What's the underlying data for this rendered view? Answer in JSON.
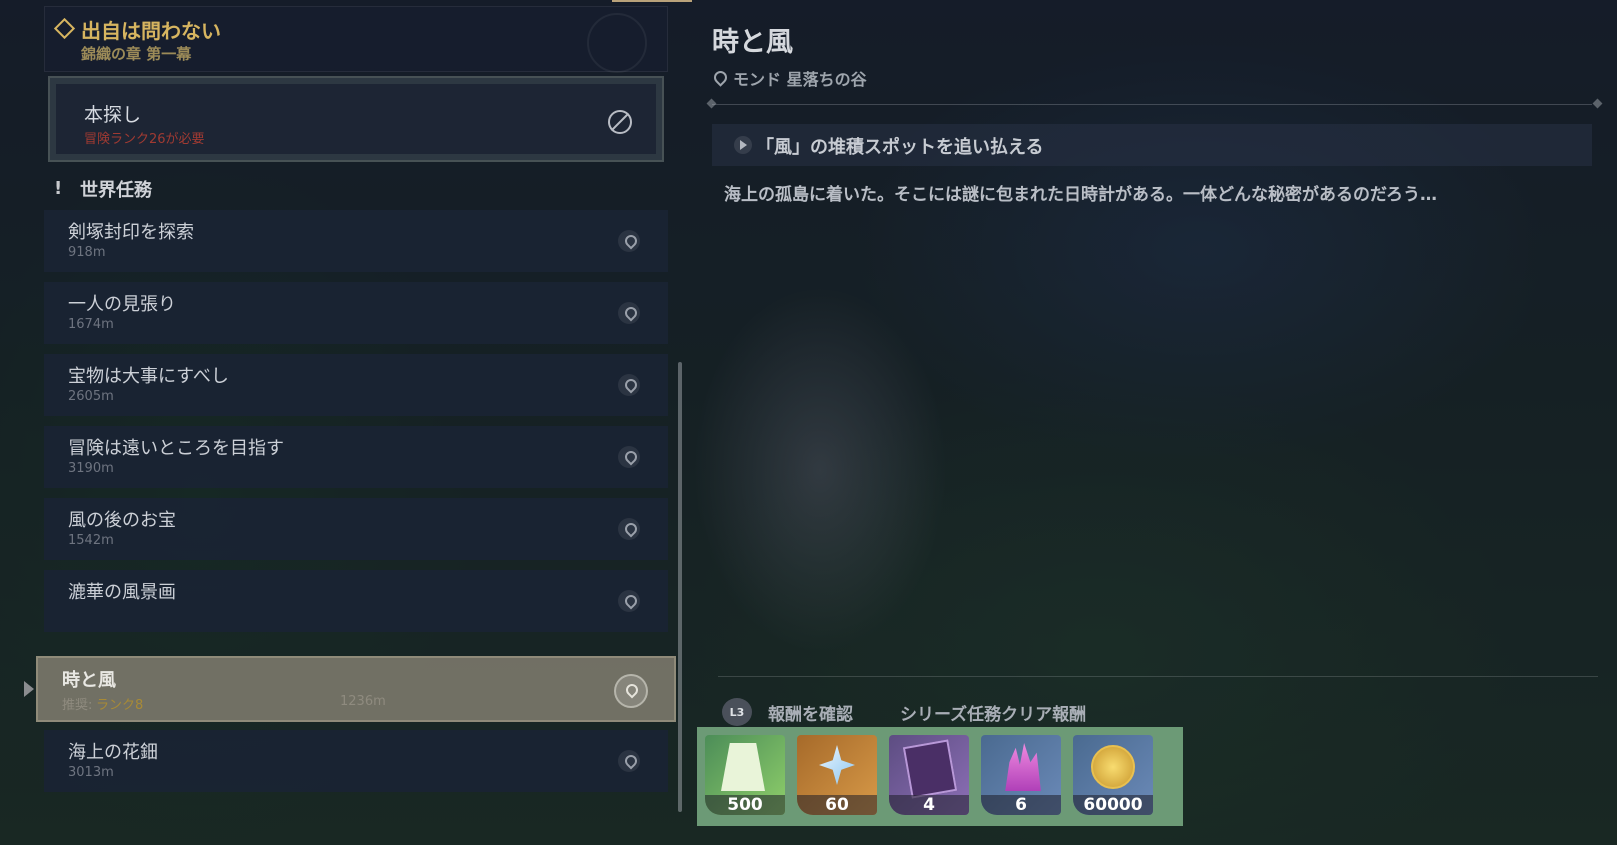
{
  "chapter": {
    "title": "出自は問わない",
    "subtitle": "錦織の章 第一幕"
  },
  "main_quest": {
    "title": "本探し",
    "requirement": "冒険ランク26が必要"
  },
  "section": {
    "label": "世界任務"
  },
  "quests": [
    {
      "name": "剣塚封印を探索",
      "distance": "918m"
    },
    {
      "name": "一人の見張り",
      "distance": "1674m"
    },
    {
      "name": "宝物は大事にすべし",
      "distance": "2605m"
    },
    {
      "name": "冒険は遠いところを目指す",
      "distance": "3190m"
    },
    {
      "name": "風の後のお宝",
      "distance": "1542m"
    },
    {
      "name": "漉華の風景画",
      "distance": ""
    },
    {
      "name": "時と風",
      "recommended_label": "推奨:",
      "recommended_value": "ランク8",
      "distance": "1236m",
      "selected": true
    },
    {
      "name": "海上の花鈿",
      "distance": "3013m"
    }
  ],
  "detail": {
    "title": "時と風",
    "location": "モンド 星落ちの谷",
    "objective": "「風」の堆積スポットを追い払える",
    "description": "海上の孤島に着いた。そこには謎に包まれた日時計がある。一体どんな秘密があるのだろう…",
    "l3_label": "L3",
    "reward_check": "報酬を確認",
    "series_reward": "シリーズ任務クリア報酬"
  },
  "rewards": [
    {
      "icon": "adventure-exp-icon",
      "amount": "500"
    },
    {
      "icon": "primogem-icon",
      "amount": "60"
    },
    {
      "icon": "heros-wit-book-icon",
      "amount": "4"
    },
    {
      "icon": "mystic-crystal-icon",
      "amount": "6"
    },
    {
      "icon": "mora-coin-icon",
      "amount": "60000"
    }
  ],
  "colors": {
    "accent_gold": "#d7b560",
    "requirement_red": "#a03a32",
    "rewards_bg": "#6c9a76"
  }
}
